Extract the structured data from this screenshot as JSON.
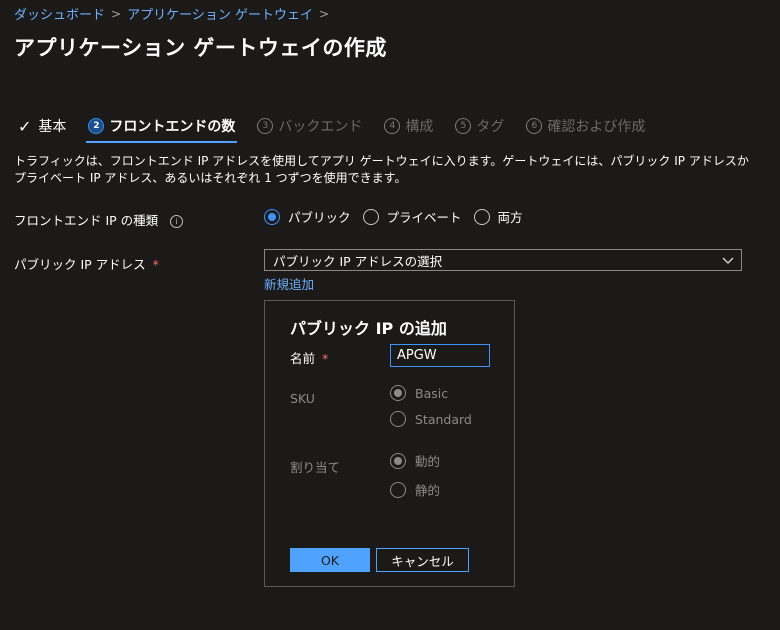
{
  "breadcrumb": {
    "items": [
      "ダッシュボード",
      "アプリケーション ゲートウェイ"
    ],
    "separator": ">"
  },
  "page_title": "アプリケーション ゲートウェイの作成",
  "tabs": [
    {
      "number": "",
      "label": "基本",
      "state": "completed"
    },
    {
      "number": "2",
      "label": "フロントエンドの数",
      "state": "active"
    },
    {
      "number": "3",
      "label": "バックエンド",
      "state": "disabled"
    },
    {
      "number": "4",
      "label": "構成",
      "state": "disabled"
    },
    {
      "number": "5",
      "label": "タグ",
      "state": "disabled"
    },
    {
      "number": "6",
      "label": "確認および作成",
      "state": "disabled"
    }
  ],
  "description": "トラフィックは、フロントエンド IP アドレスを使用してアプリ ゲートウェイに入ります。ゲートウェイには、パブリック IP アドレスかプライベート IP アドレス、あるいはそれぞれ 1 つずつを使用できます。",
  "frontend_ip_type": {
    "label": "フロントエンド IP の種類",
    "info_icon": "i",
    "options": [
      "パブリック",
      "プライベート",
      "両方"
    ],
    "selected": "パブリック"
  },
  "public_ip": {
    "label": "パブリック IP アドレス",
    "required_mark": "*",
    "select_value": "パブリック IP アドレスの選択",
    "add_new_link": "新規追加"
  },
  "add_panel": {
    "title": "パブリック IP の追加",
    "name_label": "名前",
    "required_mark": "*",
    "name_value": "APGW",
    "sku_label": "SKU",
    "sku_options": [
      "Basic",
      "Standard"
    ],
    "sku_selected": "Basic",
    "assignment_label": "割り当て",
    "assignment_options": [
      "動的",
      "静的"
    ],
    "assignment_selected": "動的",
    "ok_label": "OK",
    "cancel_label": "キャンセル"
  },
  "colors": {
    "background": "#1b1a19",
    "accent": "#4fa3ff",
    "link": "#6fb0ff",
    "required": "#ff6b6b",
    "disabled": "#8a8a8a"
  }
}
